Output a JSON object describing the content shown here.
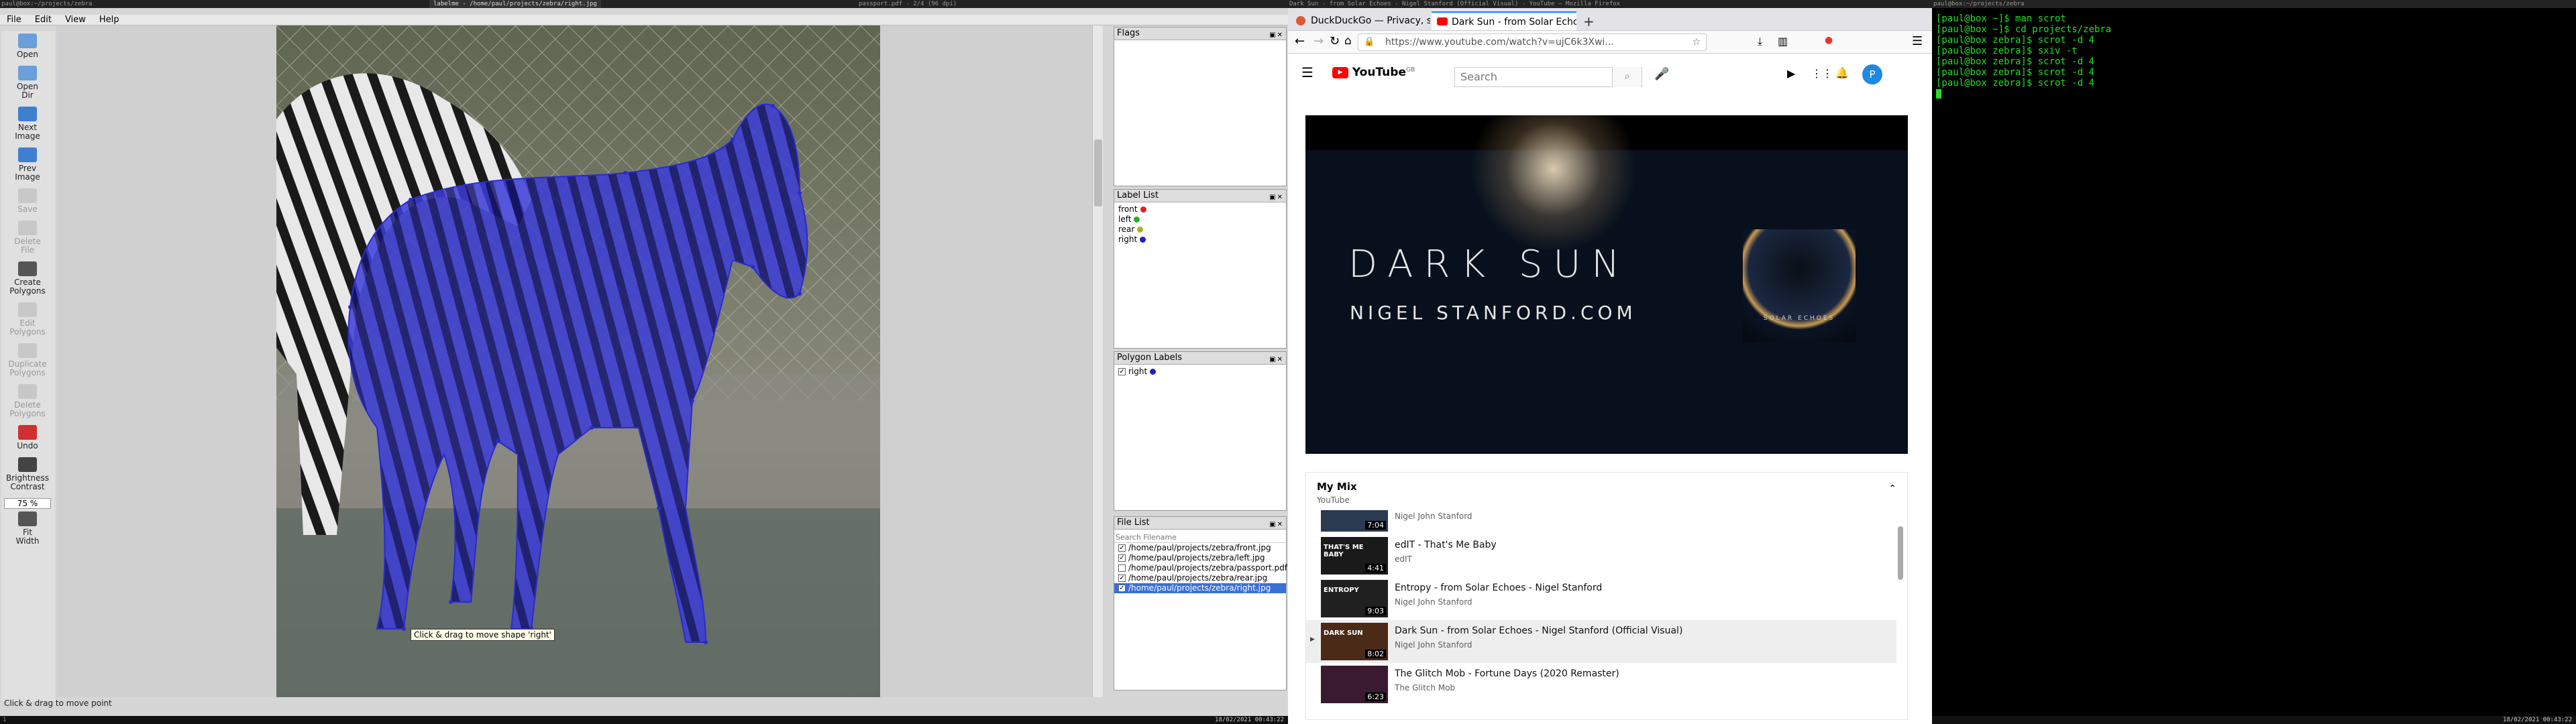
{
  "screen1": {
    "topbar_left": "paul@box:~/projects/zebra",
    "topbar_center": "labelme - /home/paul/projects/zebra/right.jpg",
    "topbar_right": "passport.pdf - 2/4 (96 dpi)",
    "menu": [
      "File",
      "Edit",
      "View",
      "Help"
    ],
    "tools": [
      {
        "label": "Open",
        "icon": "folder-icon",
        "enabled": true
      },
      {
        "label": "Open\nDir",
        "icon": "folder-icon",
        "enabled": true
      },
      {
        "label": "Next\nImage",
        "icon": "arrow-right-icon",
        "enabled": true
      },
      {
        "label": "Prev\nImage",
        "icon": "arrow-left-icon",
        "enabled": true
      },
      {
        "label": "Save",
        "icon": "save-icon",
        "enabled": false
      },
      {
        "label": "Delete\nFile",
        "icon": "delete-icon",
        "enabled": false
      },
      {
        "label": "Create\nPolygons",
        "icon": "polygon-icon",
        "enabled": true
      },
      {
        "label": "Edit\nPolygons",
        "icon": "edit-icon",
        "enabled": false
      },
      {
        "label": "Duplicate\nPolygons",
        "icon": "copy-icon",
        "enabled": false
      },
      {
        "label": "Delete\nPolygons",
        "icon": "cancel-icon",
        "enabled": false
      },
      {
        "label": "Undo",
        "icon": "undo-icon",
        "enabled": true
      },
      {
        "label": "Brightness\nContrast",
        "icon": "brightness-icon",
        "enabled": true
      }
    ],
    "zoom": "75 %",
    "fit_width": "Fit\nWidth",
    "tooltip": "Click & drag to move shape 'right'",
    "status": "Click & drag to move point",
    "docks": {
      "flags_title": "Flags",
      "label_list_title": "Label List",
      "labels": [
        {
          "name": "front",
          "color": "#e02020"
        },
        {
          "name": "left",
          "color": "#20b020"
        },
        {
          "name": "rear",
          "color": "#b0b020"
        },
        {
          "name": "right",
          "color": "#2020c0"
        }
      ],
      "polygon_labels_title": "Polygon Labels",
      "polygon_labels": [
        {
          "name": "right",
          "color": "#2020c0",
          "checked": true
        }
      ],
      "file_list_title": "File List",
      "search_placeholder": "Search Filename",
      "files": [
        {
          "path": "/home/paul/projects/zebra/front.jpg",
          "checked": true,
          "selected": false
        },
        {
          "path": "/home/paul/projects/zebra/left.jpg",
          "checked": true,
          "selected": false
        },
        {
          "path": "/home/paul/projects/zebra/passport.pdf",
          "checked": false,
          "selected": false
        },
        {
          "path": "/home/paul/projects/zebra/rear.jpg",
          "checked": true,
          "selected": false
        },
        {
          "path": "/home/paul/projects/zebra/right.jpg",
          "checked": true,
          "selected": true
        }
      ]
    },
    "clock": "18/02/2021 00:43:22"
  },
  "screen2": {
    "topbar": "Dark Sun - from Solar Echoes - Nigel Stanford (Official Visual) - YouTube — Mozilla Firefox",
    "tabs": [
      {
        "title": "DuckDuckGo — Privacy, simplified."
      },
      {
        "title": "Dark Sun - from Solar Echoes"
      }
    ],
    "url": "https://www.youtube.com/watch?v=ujC6k3Xwi...",
    "search_placeholder": "Search",
    "avatar_letter": "P",
    "logo_text": "YouTube",
    "logo_region": "GB",
    "video": {
      "title_text": "DARK SUN",
      "site_text": "NIGEL STANFORD.COM",
      "album_text": "SOLAR ECHOES"
    },
    "mix": {
      "title": "My Mix",
      "subtitle": "YouTube"
    },
    "playlist": [
      {
        "title": "",
        "channel": "Nigel John Stanford",
        "duration": "7:04",
        "thumb": "",
        "active": false
      },
      {
        "title": "edIT - That's Me Baby",
        "channel": "edIT",
        "duration": "4:41",
        "thumb": "THAT'S ME BABY",
        "active": false
      },
      {
        "title": "Entropy - from Solar Echoes - Nigel Stanford",
        "channel": "Nigel John Stanford",
        "duration": "9:03",
        "thumb": "ENTROPY",
        "active": false
      },
      {
        "title": "Dark Sun - from Solar Echoes - Nigel Stanford (Official Visual)",
        "channel": "Nigel John Stanford",
        "duration": "8:02",
        "thumb": "DARK SUN",
        "active": true
      },
      {
        "title": "The Glitch Mob - Fortune Days (2020 Remaster)",
        "channel": "The Glitch Mob",
        "duration": "6:23",
        "thumb": "",
        "active": false
      }
    ]
  },
  "screen3": {
    "topbar": "paul@box:~/projects/zebra",
    "lines": [
      "[paul@box ~]$ man scrot",
      "[paul@box ~]$ cd projects/zebra",
      "[paul@box zebra]$ scrot -d 4",
      "[paul@box zebra]$ sxiv -t",
      "[paul@box zebra]$ scrot -d 4",
      "[paul@box zebra]$ scrot -d 4",
      "[paul@box zebra]$ scrot -d 4"
    ],
    "clock": "18/02/2021 00:43:22"
  }
}
